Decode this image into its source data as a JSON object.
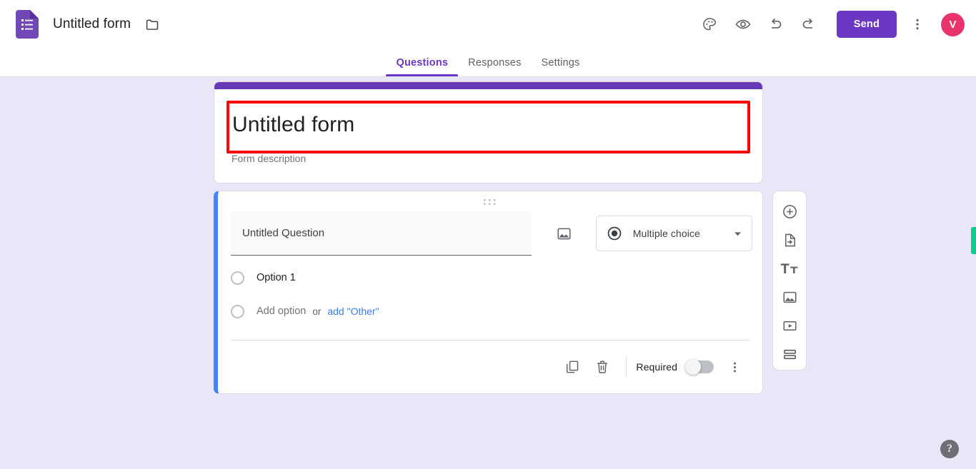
{
  "appbar": {
    "logo_icon": "google-forms-logo",
    "doc_title": "Untitled form",
    "folder_icon": "folder-icon",
    "theme_icon": "palette-icon",
    "preview_icon": "eye-icon",
    "undo_icon": "undo-icon",
    "redo_icon": "redo-icon",
    "send_label": "Send",
    "more_icon": "more-vert-icon",
    "avatar_initial": "V",
    "avatar_color": "#E8336D",
    "accent_color": "#6A38C2"
  },
  "tabs": [
    {
      "label": "Questions",
      "active": true
    },
    {
      "label": "Responses",
      "active": false
    },
    {
      "label": "Settings",
      "active": false
    }
  ],
  "form_header": {
    "strip_color": "#673AB7",
    "title_value": "Untitled form",
    "description_placeholder": "Form description",
    "highlight_color": "#FF0000"
  },
  "question": {
    "accent_color": "#4285F4",
    "drag_handle_icon": "drag-handle-icon",
    "title_value": "Untitled Question",
    "image_icon": "add-image-icon",
    "type_icon": "radio-selected-icon",
    "type_label": "Multiple choice",
    "dropdown_icon": "chevron-down-icon",
    "options": [
      {
        "label": "Option 1",
        "placeholder": false
      }
    ],
    "add_option_label": "Add option",
    "or_label": "or",
    "add_other_label": "add \"Other\"",
    "footer": {
      "duplicate_icon": "duplicate-icon",
      "delete_icon": "trash-icon",
      "required_label": "Required",
      "required_on": false,
      "more_icon": "more-vert-icon"
    }
  },
  "side_toolbar": [
    {
      "name": "add-question-button",
      "icon": "plus-circle-icon"
    },
    {
      "name": "import-questions-button",
      "icon": "import-file-icon"
    },
    {
      "name": "add-title-description-button",
      "icon": "text-tt-icon"
    },
    {
      "name": "add-image-button",
      "icon": "image-icon"
    },
    {
      "name": "add-video-button",
      "icon": "video-icon"
    },
    {
      "name": "add-section-button",
      "icon": "section-icon"
    }
  ],
  "help": {
    "label": "?",
    "icon": "help-icon"
  },
  "edge_marker": {
    "color": "#0BCE8B"
  }
}
